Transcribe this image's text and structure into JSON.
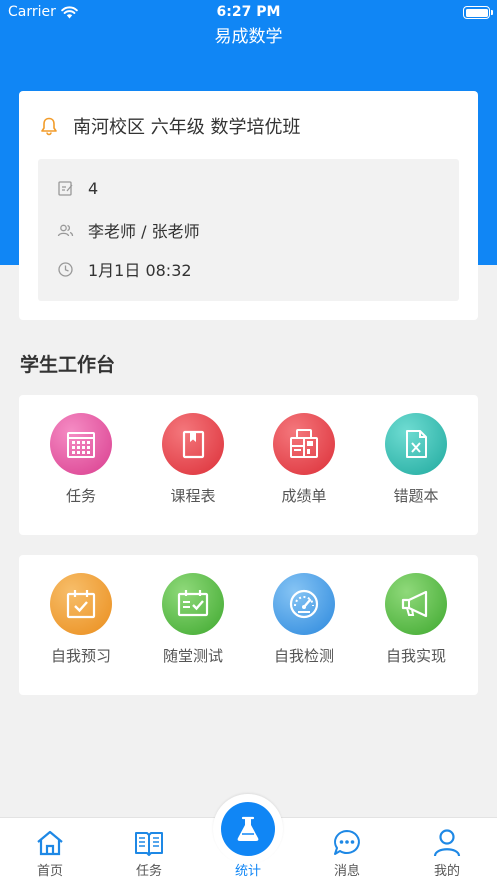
{
  "status_bar": {
    "carrier": "Carrier",
    "time": "6:27 PM"
  },
  "header": {
    "title": "易成数学"
  },
  "class_card": {
    "class_name": "南河校区 六年级 数学培优班",
    "count": "4",
    "teachers": "李老师 / 张老师",
    "time": "1月1日 08:32"
  },
  "workbench": {
    "title": "学生工作台",
    "row1": [
      {
        "label": "任务",
        "icon": "calendar-grid-icon",
        "color": "#e54a9a"
      },
      {
        "label": "课程表",
        "icon": "bookmark-book-icon",
        "color": "#e8434a"
      },
      {
        "label": "成绩单",
        "icon": "report-clipboard-icon",
        "color": "#e8434a"
      },
      {
        "label": "错题本",
        "icon": "wrong-file-icon",
        "color": "#2bbfb3"
      }
    ],
    "row2": [
      {
        "label": "自我预习",
        "icon": "calendar-check-icon",
        "color": "#f29c2a"
      },
      {
        "label": "随堂测试",
        "icon": "checklist-board-icon",
        "color": "#4fba3f"
      },
      {
        "label": "自我检测",
        "icon": "speedometer-icon",
        "color": "#3a9ae8"
      },
      {
        "label": "自我实现",
        "icon": "megaphone-icon",
        "color": "#4fba3f"
      }
    ]
  },
  "tabbar": {
    "items": [
      {
        "label": "首页",
        "icon": "home-icon"
      },
      {
        "label": "任务",
        "icon": "book-icon"
      },
      {
        "label": "统计",
        "icon": "flask-icon",
        "active": true
      },
      {
        "label": "消息",
        "icon": "chat-icon"
      },
      {
        "label": "我的",
        "icon": "person-icon"
      }
    ],
    "active_color": "#1086f5"
  }
}
